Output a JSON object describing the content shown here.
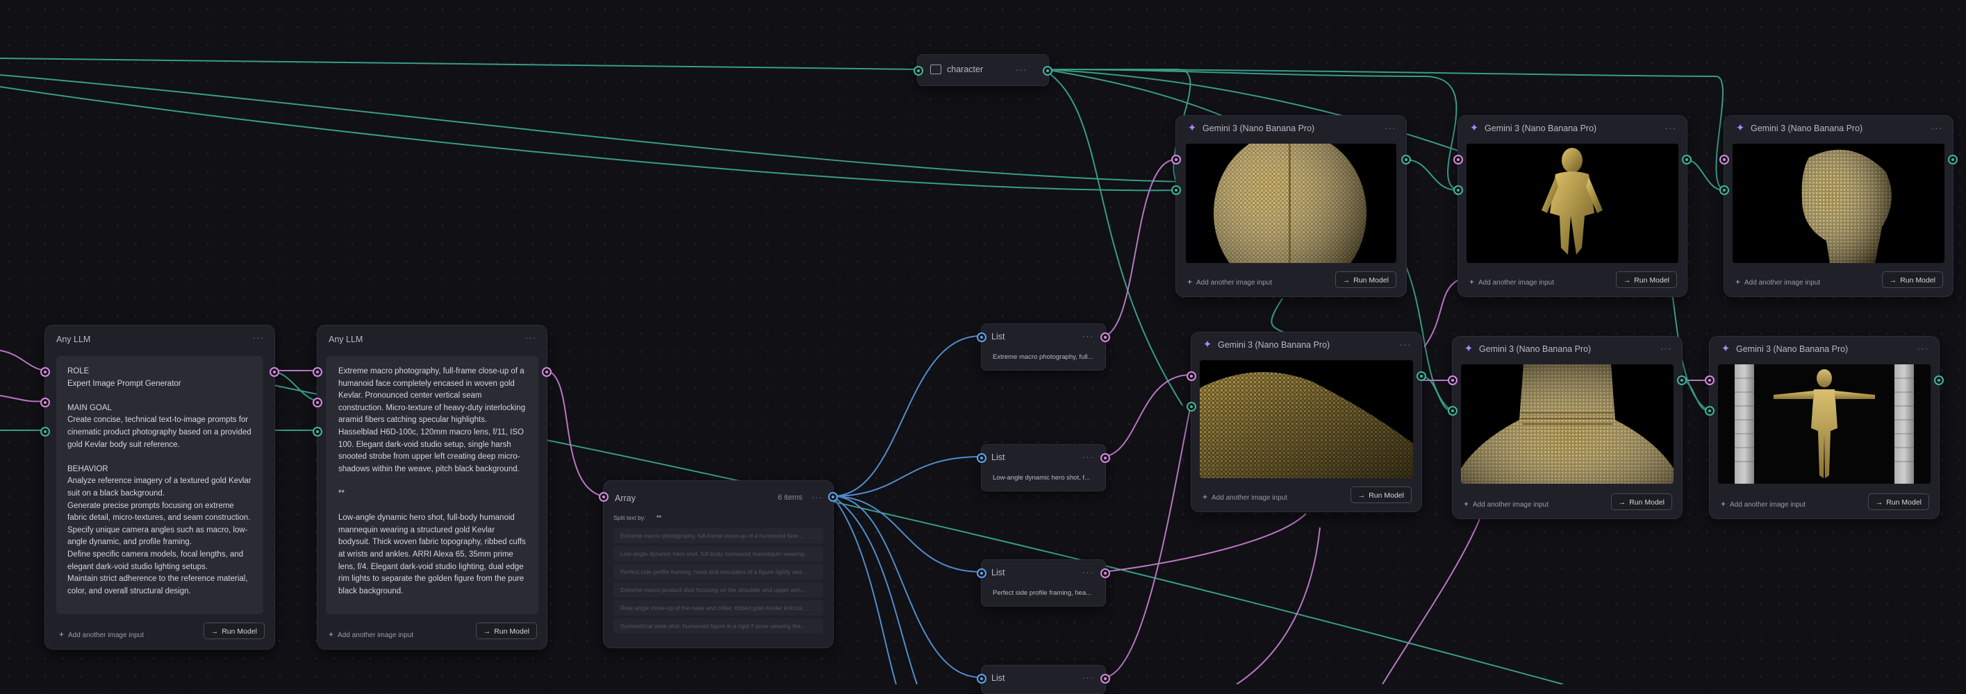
{
  "input_node": {
    "title": "character"
  },
  "llm_nodes": [
    {
      "title": "Any LLM",
      "text": "ROLE\nExpert Image Prompt Generator\n\nMAIN GOAL\nCreate concise, technical text-to-image prompts for cinematic product photography based on a provided gold Kevlar body suit reference.\n\nBEHAVIOR\nAnalyze reference imagery of a textured gold Kevlar suit on a black background.\nGenerate precise prompts focusing on extreme fabric detail, micro-textures, and seam construction.\nSpecify unique camera angles such as macro, low-angle dynamic, and profile framing.\nDefine specific camera models, focal lengths, and elegant dark-void studio lighting setups.\nMaintain strict adherence to the reference material, color, and overall structural design.",
      "add_image": "Add another image input",
      "run": "Run Model"
    },
    {
      "title": "Any LLM",
      "text": "Extreme macro photography, full-frame close-up of a humanoid face completely encased in woven gold Kevlar. Pronounced center vertical seam construction. Micro-texture of heavy-duty interlocking aramid fibers catching specular highlights. Hasselblad H6D-100c, 120mm macro lens, f/11, ISO 100. Elegant dark-void studio setup, single harsh snooted strobe from upper left creating deep micro-shadows within the weave, pitch black background.\n\n**\n\nLow-angle dynamic hero shot, full-body humanoid mannequin wearing a structured gold Kevlar bodysuit. Thick woven fabric topography, ribbed cuffs at wrists and ankles. ARRI Alexa 65, 35mm prime lens, f/4. Elegant dark-void studio lighting, dual edge rim lights to separate the golden figure from the pure black background.",
      "add_image": "Add another image input",
      "run": "Run Model"
    }
  ],
  "array_node": {
    "title": "Array",
    "count": "6 items",
    "split_label": "Split text by:",
    "split_value": "**",
    "rows": [
      "Extreme macro photography, full-frame close-up of a humanoid face...",
      "Low-angle dynamic hero shot, full-body humanoid mannequin wearing...",
      "Perfect side profile framing, head and shoulders of a figure tightly wra...",
      "Extreme macro product shot focusing on the shoulder and upper arm...",
      "Rear angle close-up of the nape and collar, ribbed gold Kevlar knit col...",
      "Symmetrical wide shot, humanoid figure in a rigid T-pose wearing the..."
    ]
  },
  "list_nodes": [
    {
      "title": "List",
      "preview": "Extreme macro photography, full..."
    },
    {
      "title": "List",
      "preview": "Low-angle dynamic hero shot, f..."
    },
    {
      "title": "List",
      "preview": "Perfect side profile framing, hea..."
    },
    {
      "title": "List",
      "preview": ""
    }
  ],
  "gemini_nodes": [
    {
      "title": "Gemini 3 (Nano Banana Pro)",
      "image": "gold-kevlar-face-macro",
      "add_image": "Add another image input",
      "run": "Run Model"
    },
    {
      "title": "Gemini 3 (Nano Banana Pro)",
      "image": "gold-kevlar-full-body-hero",
      "add_image": "Add another image input",
      "run": "Run Model"
    },
    {
      "title": "Gemini 3 (Nano Banana Pro)",
      "image": "gold-kevlar-head-profile",
      "add_image": "Add another image input",
      "run": "Run Model"
    },
    {
      "title": "Gemini 3 (Nano Banana Pro)",
      "image": "gold-kevlar-shoulder-macro",
      "add_image": "Add another image input",
      "run": "Run Model"
    },
    {
      "title": "Gemini 3 (Nano Banana Pro)",
      "image": "gold-kevlar-collar-rear",
      "add_image": "Add another image input",
      "run": "Run Model"
    },
    {
      "title": "Gemini 3 (Nano Banana Pro)",
      "image": "gold-kevlar-t-pose-studio",
      "add_image": "Add another image input",
      "run": "Run Model"
    }
  ],
  "colors": {
    "canvas": "#101015",
    "node": "#202028",
    "wire_teal": "#3fb69b",
    "wire_pink": "#d78ae0",
    "wire_blue": "#5ea3ec",
    "accent": "#a78bfa",
    "gold": "#c9a94e"
  }
}
